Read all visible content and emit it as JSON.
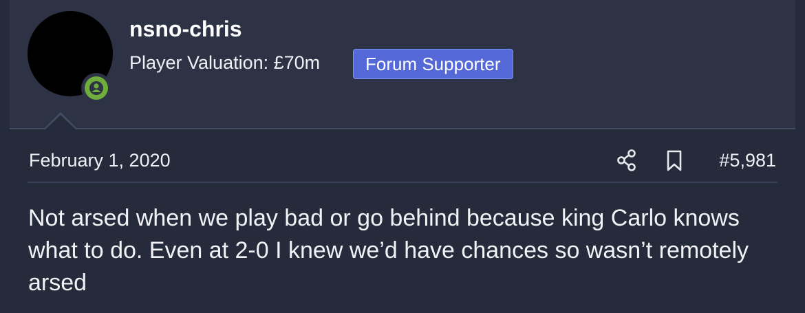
{
  "user": {
    "username": "nsno-chris",
    "valuation": "Player Valuation: £70m",
    "badge": "Forum Supporter",
    "status_icon": "user-online-icon"
  },
  "post": {
    "date": "February 1, 2020",
    "number": "#5,981",
    "body": "Not arsed when we play bad or go behind because king Carlo knows what to do. Even at 2-0 I knew we’d have chances so wasn’t remotely arsed"
  },
  "icons": {
    "share": "share-icon",
    "bookmark": "bookmark-icon"
  },
  "colors": {
    "badge_bg": "#5468d8",
    "online_status": "#6fae3c",
    "background": "#262b3b"
  }
}
